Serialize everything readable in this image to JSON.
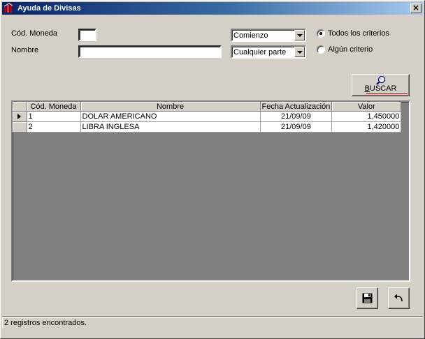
{
  "window": {
    "title": "Ayuda de Divisas",
    "close_label": "×"
  },
  "form": {
    "code_label": "Cód. Moneda",
    "code_value": "",
    "name_label": "Nombre",
    "name_value": "",
    "code_match": "Comienzo",
    "name_match": "Cualquier parte",
    "criteria_all_label": "Todos los criterios",
    "criteria_any_label": "Algún criterio",
    "criteria_selected": "all"
  },
  "search_button": {
    "label": "BUSCAR"
  },
  "grid": {
    "columns": [
      "Cód. Moneda",
      "Nombre",
      "Fecha Actualización",
      "Valor"
    ],
    "rows": [
      {
        "code": "1",
        "name": "DOLAR AMERICANO",
        "date": "21/09/09",
        "value": "1,450000",
        "selected": true
      },
      {
        "code": "2",
        "name": "LIBRA INGLESA",
        "date": "21/09/09",
        "value": "1,420000",
        "selected": false
      }
    ]
  },
  "status": {
    "text": "2 registros encontrados."
  },
  "icons": {
    "app": "app-logo-icon",
    "search": "magnifier-icon",
    "save": "floppy-disk-icon",
    "back": "undo-arrow-icon"
  },
  "colors": {
    "titlebar_start": "#0a246a",
    "titlebar_end": "#a6caf0",
    "face": "#d4d0c8"
  }
}
